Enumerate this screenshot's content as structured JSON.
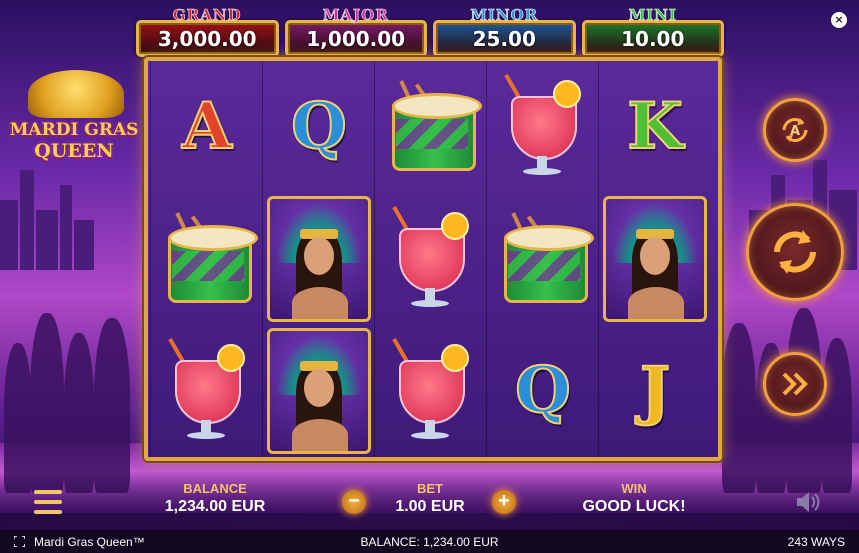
{
  "jackpots": [
    {
      "label": "GRAND",
      "value": "3,000.00",
      "label_color": "#d8202a",
      "box_color": "#9a101a"
    },
    {
      "label": "MAJOR",
      "value": "1,000.00",
      "label_color": "#d0309a",
      "box_color": "#7a1a6a"
    },
    {
      "label": "MINOR",
      "value": "25.00",
      "label_color": "#2a8ed8",
      "box_color": "#1a5a9a"
    },
    {
      "label": "MINI",
      "value": "10.00",
      "label_color": "#3ac040",
      "box_color": "#1a7a2a"
    }
  ],
  "logo": {
    "line1": "MARDI GRAS",
    "line2": "QUEEN"
  },
  "reels": [
    [
      "A",
      "drum",
      "drink"
    ],
    [
      "Q",
      "queen",
      "queen"
    ],
    [
      "drum",
      "drink",
      "drink"
    ],
    [
      "drink",
      "drum",
      "Q"
    ],
    [
      "K",
      "queen",
      "J"
    ]
  ],
  "controls": {
    "autoplay_icon": "autoplay-icon",
    "spin_icon": "spin-icon",
    "turbo_icon": "turbo-icon",
    "close_label": "×",
    "accent_color": "#f0a040"
  },
  "hud": {
    "balance_label": "BALANCE",
    "balance_value": "1,234.00 EUR",
    "bet_label": "BET",
    "bet_value": "1.00 EUR",
    "win_label": "WIN",
    "win_value": "GOOD LUCK!",
    "minus_label": "−",
    "plus_label": "+"
  },
  "footer": {
    "game_name": "Mardi Gras Queen™",
    "balance": "BALANCE: 1,234.00 EUR",
    "ways": "243 WAYS"
  }
}
